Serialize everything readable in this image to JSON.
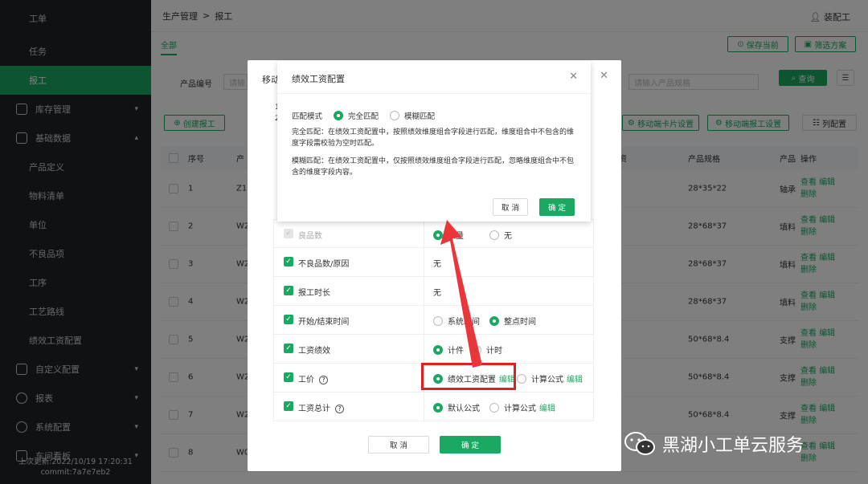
{
  "sidebar": {
    "items": [
      {
        "label": "工单"
      },
      {
        "label": "任务"
      },
      {
        "label": "报工"
      },
      {
        "label": "库存管理"
      },
      {
        "label": "基础数据"
      },
      {
        "label": "产品定义"
      },
      {
        "label": "物料清单"
      },
      {
        "label": "单位"
      },
      {
        "label": "不良品项"
      },
      {
        "label": "工序"
      },
      {
        "label": "工艺路线"
      },
      {
        "label": "绩效工资配置"
      },
      {
        "label": "自定义配置"
      },
      {
        "label": "报表"
      },
      {
        "label": "系统配置"
      },
      {
        "label": "车间看板"
      }
    ],
    "footer_line1": "上次更新:2022/10/19 17:20:31",
    "footer_line2": "commit:7a7e7eb2"
  },
  "header": {
    "breadcrumb_parent": "生产管理",
    "breadcrumb_sep": ">",
    "breadcrumb_current": "报工",
    "user": "装配工"
  },
  "tabs": {
    "all": "全部"
  },
  "toolbar": {
    "save_current": "保存当前",
    "filter_plan": "筛选方案",
    "product_code_label": "产品编号",
    "product_code_placeholder": "请输",
    "spec_placeholder": "请输入产品规格",
    "query": "查询",
    "create_report": "创建报工",
    "mobile_card": "移动端卡片设置",
    "mobile_report": "移动端报工设置",
    "column_config": "列配置"
  },
  "table": {
    "headers": {
      "seq": "序号",
      "product": "产",
      "wage": "资",
      "spec": "产品规格",
      "name": "产品",
      "ops": "操作"
    },
    "rows": [
      {
        "seq": "1",
        "code": "Z15",
        "spec": "28*35*22",
        "name": "轴承"
      },
      {
        "seq": "2",
        "code": "W2",
        "spec": "28*68*37",
        "name": "填料"
      },
      {
        "seq": "3",
        "code": "W2",
        "spec": "28*68*37",
        "name": "填料"
      },
      {
        "seq": "4",
        "code": "W2",
        "spec": "28*68*37",
        "name": "填料"
      },
      {
        "seq": "5",
        "code": "W2",
        "spec": "50*68*8.4",
        "name": "支撑"
      },
      {
        "seq": "6",
        "code": "W2",
        "spec": "50*68*8.4",
        "name": "支撑"
      },
      {
        "seq": "7",
        "code": "W2",
        "spec": "50*68*8.4",
        "name": "支撑"
      },
      {
        "seq": "8",
        "code": "W0",
        "spec": "",
        "name": ""
      }
    ],
    "op_view": "查看",
    "op_edit": "编辑",
    "op_delete": "删除"
  },
  "modal2": {
    "title": "移动",
    "partial_text_1": "1",
    "partial_text_2": "2",
    "rows": [
      {
        "name": "良品数",
        "opt1": "数量",
        "opt2": "无"
      },
      {
        "name": "不良品数/原因",
        "value": "无"
      },
      {
        "name": "报工时长",
        "value": "无"
      },
      {
        "name": "开始/结束时间",
        "opt1": "系统时间",
        "opt2": "整点时间"
      },
      {
        "name": "工资绩效",
        "opt1": "计件",
        "opt2": "计时"
      },
      {
        "name": "工价",
        "opt1": "绩效工资配置",
        "opt1_link": "编辑",
        "opt2": "计算公式",
        "opt2_link": "编辑"
      },
      {
        "name": "工资总计",
        "opt1": "默认公式",
        "opt2": "计算公式",
        "opt2_link": "编辑"
      }
    ],
    "cancel": "取 消",
    "ok": "确 定"
  },
  "modal1": {
    "title": "绩效工资配置",
    "match_mode_label": "匹配模式",
    "exact_match": "完全匹配",
    "fuzzy_match": "模糊匹配",
    "exact_desc": "完全匹配：在绩效工资配置中，按照绩效维度组合字段进行匹配，维度组合中不包含的维度字段需校验为空时匹配。",
    "fuzzy_desc": "模糊匹配：在绩效工资配置中，仅按照绩效维度组合字段进行匹配，忽略维度组合中不包含的维度字段内容。",
    "cancel": "取 消",
    "ok": "确 定"
  },
  "watermark": "黑湖小工单云服务",
  "colors": {
    "accent": "#1aa862",
    "highlight": "#e02020",
    "sidebar": "#1f2329"
  }
}
